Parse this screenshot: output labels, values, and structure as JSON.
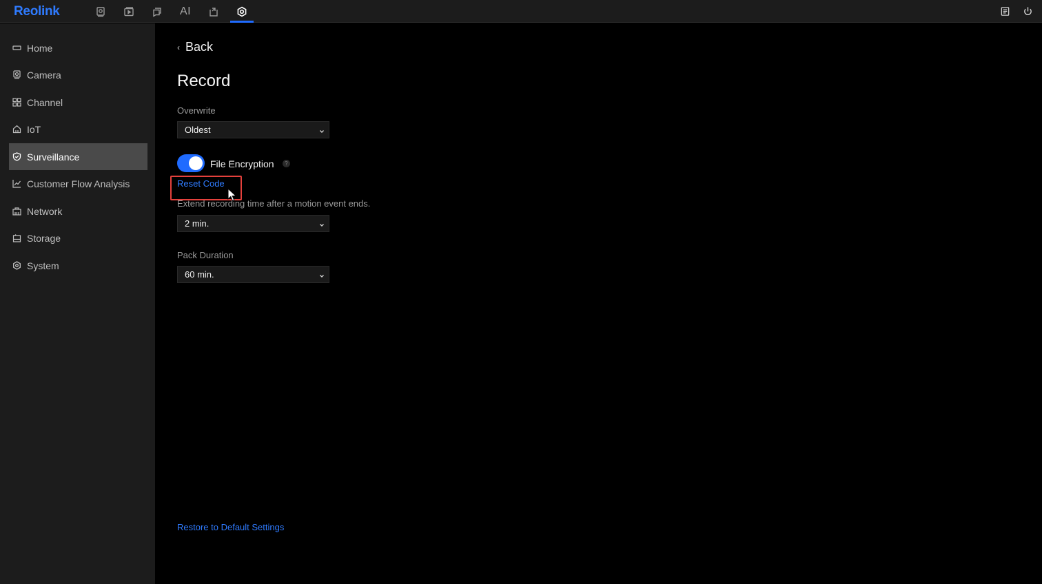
{
  "app": {
    "logo": "Reolink",
    "brand_color": "#2f7bff"
  },
  "topbar": {
    "icons": [
      "camera-view-icon",
      "playback-icon",
      "messages-icon",
      "ai-icon",
      "download-icon",
      "settings-icon"
    ],
    "ai_label": "AI",
    "active": "settings-icon",
    "right_icons": [
      "notes-icon",
      "power-icon"
    ]
  },
  "sidebar": {
    "items": [
      {
        "label": "Home",
        "icon": "home-icon"
      },
      {
        "label": "Camera",
        "icon": "camera-icon"
      },
      {
        "label": "Channel",
        "icon": "channel-icon"
      },
      {
        "label": "IoT",
        "icon": "iot-icon"
      },
      {
        "label": "Surveillance",
        "icon": "shield-icon",
        "active": true
      },
      {
        "label": "Customer Flow Analysis",
        "icon": "chart-icon"
      },
      {
        "label": "Network",
        "icon": "network-icon"
      },
      {
        "label": "Storage",
        "icon": "storage-icon"
      },
      {
        "label": "System",
        "icon": "system-icon"
      }
    ]
  },
  "main": {
    "back_label": "Back",
    "title": "Record",
    "overwrite": {
      "label": "Overwrite",
      "value": "Oldest"
    },
    "file_encryption": {
      "label": "File Encryption",
      "enabled": true,
      "help": "?"
    },
    "reset_code": "Reset Code",
    "post_record": {
      "label": "Extend recording time after a motion event ends.",
      "value": "2 min."
    },
    "pack_duration": {
      "label": "Pack Duration",
      "value": "60 min."
    },
    "restore_default": "Restore to Default Settings"
  },
  "colors": {
    "accent": "#1f6bff",
    "highlight": "#e5413c",
    "sidebar_active": "#4a4a4a"
  }
}
